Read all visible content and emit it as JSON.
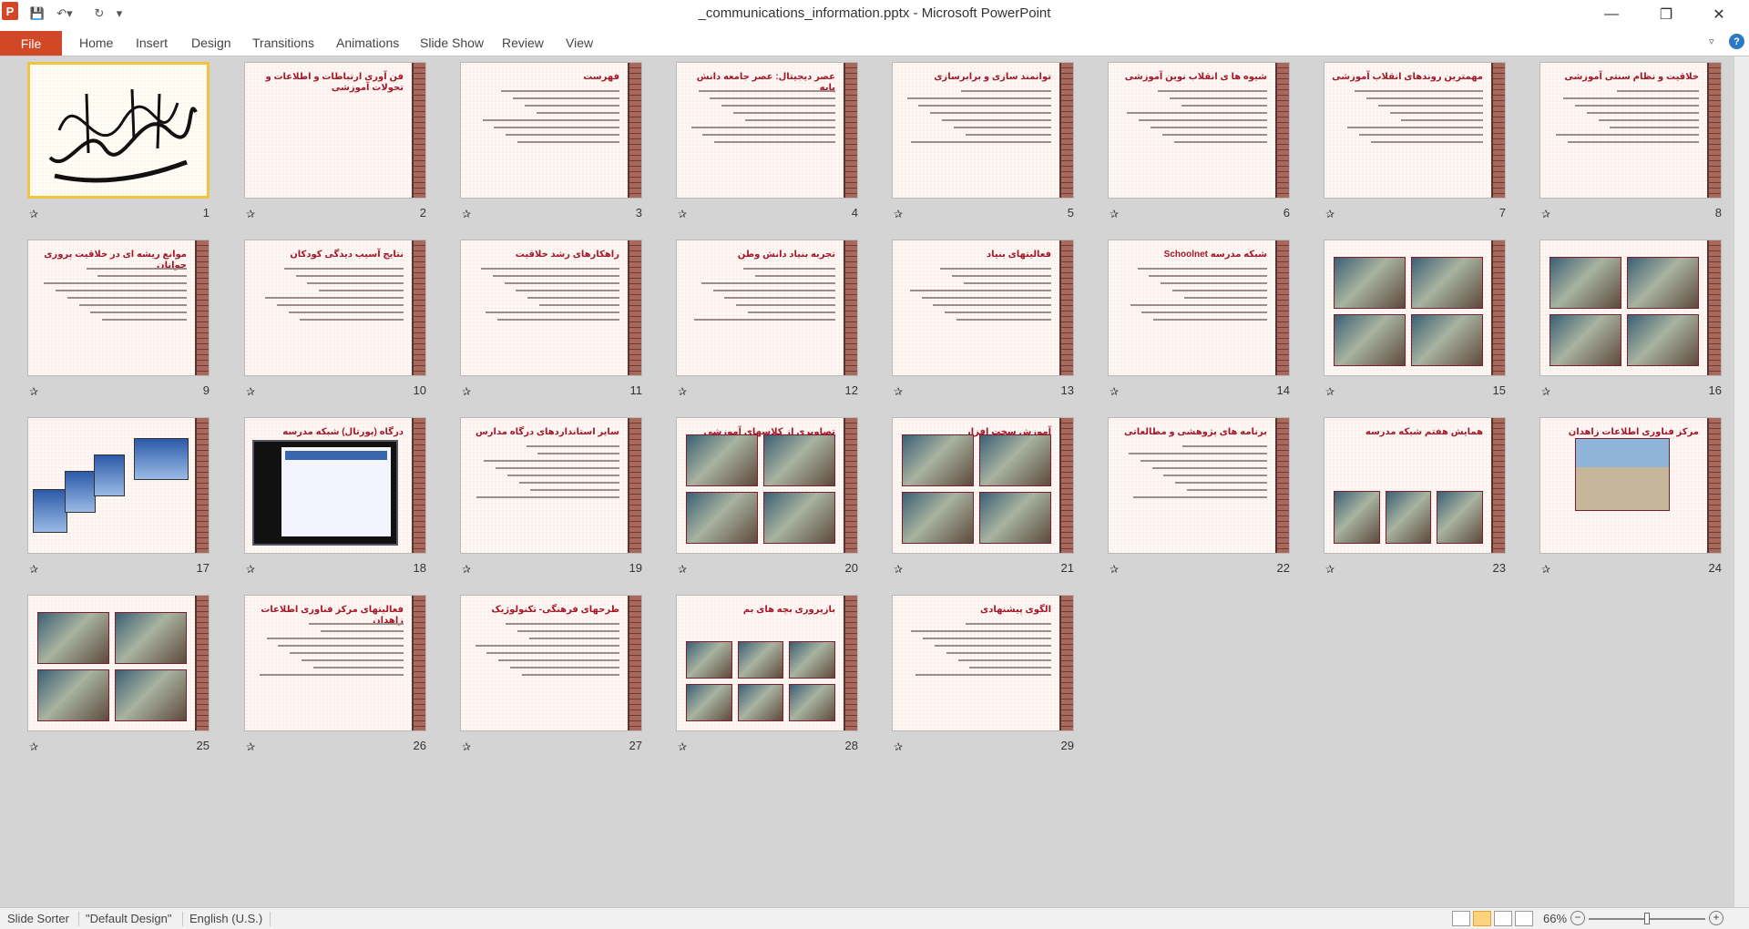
{
  "window": {
    "title": "_communications_information.pptx - Microsoft PowerPoint",
    "app_icon_letter": "P",
    "minimize_glyph": "—",
    "maximize_glyph": "❐",
    "close_glyph": "✕"
  },
  "quick_access": {
    "save_icon": "💾",
    "undo_icon": "↶▾",
    "redo_icon": "↻",
    "more_icon": "▾"
  },
  "ribbon": {
    "file": "File",
    "tabs": [
      "Home",
      "Insert",
      "Design",
      "Transitions",
      "Animations",
      "Slide Show",
      "Review",
      "View"
    ],
    "collapse_icon": "▿",
    "help": "?"
  },
  "slides": [
    {
      "number": "1",
      "title": "",
      "kind": "calligraphy",
      "selected": true
    },
    {
      "number": "2",
      "title": "فن آوری ارتباطات و اطلاعات و تحولات آموزشی",
      "kind": "title"
    },
    {
      "number": "3",
      "title": "فهرست",
      "kind": "text"
    },
    {
      "number": "4",
      "title": "عصر دیجیتال: عصر جامعه دانش پایه",
      "kind": "text"
    },
    {
      "number": "5",
      "title": "توانمند سازی و برابرسازی",
      "kind": "text"
    },
    {
      "number": "6",
      "title": "شیوه ها ی انقلاب نوین آموزشی",
      "kind": "text"
    },
    {
      "number": "7",
      "title": "مهمترین روندهای انقلاب آموزشی",
      "kind": "text"
    },
    {
      "number": "8",
      "title": "خلاقیت و نظام سنتی آموزشی",
      "kind": "text"
    },
    {
      "number": "9",
      "title": "موانع ریشه ای در خلاقیت پروری جوانان",
      "kind": "text"
    },
    {
      "number": "10",
      "title": "نتایج آسیب دیدگی کودکان",
      "kind": "text"
    },
    {
      "number": "11",
      "title": "راهکارهای رشد خلاقیت",
      "kind": "text"
    },
    {
      "number": "12",
      "title": "تجربه بنیاد دانش وطن",
      "kind": "text"
    },
    {
      "number": "13",
      "title": "فعالیتهای بنیاد",
      "kind": "text"
    },
    {
      "number": "14",
      "title": "شبکه مدرسه Schoolnet",
      "kind": "text"
    },
    {
      "number": "15",
      "title": "",
      "kind": "photos4"
    },
    {
      "number": "16",
      "title": "",
      "kind": "photos4"
    },
    {
      "number": "17",
      "title": "",
      "kind": "towers"
    },
    {
      "number": "18",
      "title": "درگاه (پورتال) شبکه مدرسه",
      "kind": "screen"
    },
    {
      "number": "19",
      "title": "سایر استانداردهای درگاه مدارس",
      "kind": "text"
    },
    {
      "number": "20",
      "title": "تصاویری از کلاسهای آموزشی",
      "kind": "photos4"
    },
    {
      "number": "21",
      "title": "آموزش سخت افزار",
      "kind": "photos4"
    },
    {
      "number": "22",
      "title": "برنامه های پژوهشی و مطالعاتی",
      "kind": "text"
    },
    {
      "number": "23",
      "title": "همایش هفتم شبکه مدرسه",
      "kind": "photos3"
    },
    {
      "number": "24",
      "title": "مرکز فناوری اطلاعات زاهدان",
      "kind": "building"
    },
    {
      "number": "25",
      "title": "",
      "kind": "photos4"
    },
    {
      "number": "26",
      "title": "فعالیتهای مرکز فناوری اطلاعات زاهدان",
      "kind": "text"
    },
    {
      "number": "27",
      "title": "طرحهای فرهنگی- تکنولوژیک",
      "kind": "text"
    },
    {
      "number": "28",
      "title": "بازپروری بچه های بم",
      "kind": "photos6"
    },
    {
      "number": "29",
      "title": "الگوی پیشنهادی",
      "kind": "text"
    }
  ],
  "status": {
    "view": "Slide Sorter",
    "theme": "\"Default Design\"",
    "language": "English (U.S.)",
    "zoom": "66%",
    "zoom_out": "−",
    "zoom_in": "+",
    "zoom_fraction": 0.5
  },
  "icons": {
    "slide_transition": "✰"
  },
  "colors": {
    "accent": "#d24726",
    "slide_title": "#a4182a",
    "sorter_bg": "#d4d4d4",
    "selected_border": "#f3c340"
  }
}
